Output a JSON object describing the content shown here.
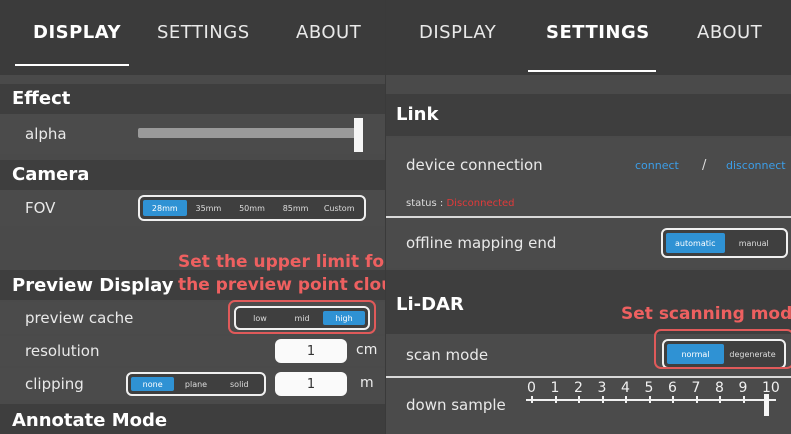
{
  "left": {
    "tabs": [
      "DISPLAY",
      "SETTINGS",
      "ABOUT"
    ],
    "effect": {
      "title": "Effect",
      "alpha_label": "alpha"
    },
    "camera": {
      "title": "Camera",
      "fov_label": "FOV",
      "fov_options": [
        "28mm",
        "35mm",
        "50mm",
        "85mm",
        "Custom"
      ],
      "fov_selected": "28mm"
    },
    "preview": {
      "title": "Preview Display",
      "cache_label": "preview cache",
      "cache_options": [
        "low",
        "mid",
        "high"
      ],
      "cache_selected": "high",
      "resolution_label": "resolution",
      "resolution_value": "1",
      "resolution_unit": "cm",
      "clipping_label": "clipping",
      "clipping_options": [
        "none",
        "plane",
        "solid"
      ],
      "clipping_selected": "none",
      "clipping_value": "1",
      "clipping_unit": "m"
    },
    "annotate": {
      "title": "Annotate Mode"
    },
    "annotation": {
      "line1": "Set the upper limit for",
      "line2": "the preview point cloud"
    }
  },
  "right": {
    "tabs": [
      "DISPLAY",
      "SETTINGS",
      "ABOUT"
    ],
    "link": {
      "title": "Link",
      "device_label": "device connection",
      "connect": "connect",
      "slash": "/",
      "disconnect": "disconnect",
      "status_label": "status : ",
      "status_value": "Disconnected",
      "status_color": "#e03a3a",
      "offline_label": "offline mapping end",
      "offline_options": [
        "automatic",
        "manual"
      ],
      "offline_selected": "automatic"
    },
    "lidar": {
      "title": "Li-DAR",
      "scan_label": "scan mode",
      "scan_options": [
        "normal",
        "degenerate"
      ],
      "scan_selected": "normal",
      "down_label": "down sample",
      "ruler_numbers": [
        "0",
        "1",
        "2",
        "3",
        "4",
        "5",
        "6",
        "7",
        "8",
        "9",
        "10"
      ],
      "down_value": 10
    },
    "annotation": {
      "text": "Set scanning mode"
    }
  },
  "colors": {
    "accent": "#2f92d4",
    "annotation": "#e05a5a",
    "link": "#3c9ee8"
  }
}
